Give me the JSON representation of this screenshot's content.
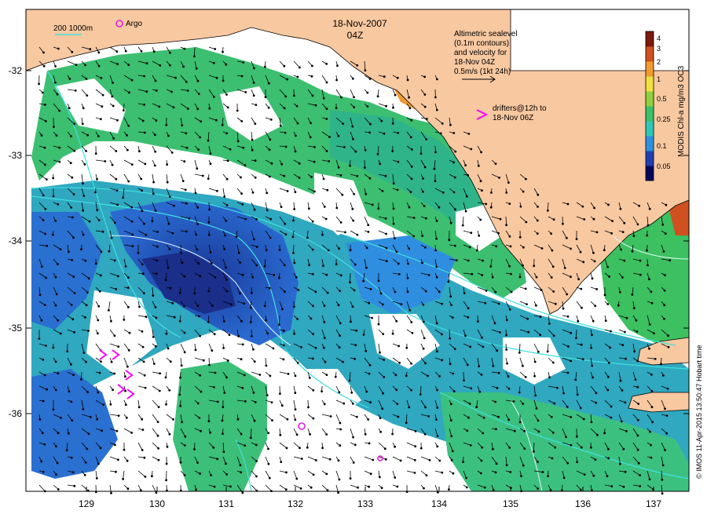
{
  "map": {
    "date_line": "18-Nov-2007",
    "time_line": "04Z",
    "scale_label": "200  1000m",
    "argo_label": "Argo",
    "altimetry_note": [
      "Altimetric sealevel",
      "(0.1m contours)",
      "and velocity for",
      "18-Nov 04Z",
      "0.5m/s (1kt 24h)"
    ],
    "drifters_note": [
      "drifters@12h to",
      "18-Nov 06Z"
    ],
    "lat_ticks": [
      "-32",
      "-33",
      "-34",
      "-35",
      "-36"
    ],
    "lon_ticks": [
      "129",
      "130",
      "131",
      "132",
      "133",
      "134",
      "135",
      "136",
      "137"
    ],
    "credit": "© IMOS 11-Apr-2015 13:50:47 Hobart time"
  },
  "colorbar": {
    "title": "MODIS Chl-a mg/m3 OC3",
    "ticks": [
      "4",
      "3",
      "2",
      "1",
      "0.5",
      "0.25",
      "0.1",
      "0.05"
    ],
    "colors": [
      "#08085a",
      "#1f3fb0",
      "#2f8fe0",
      "#2fc8b8",
      "#3cc06a",
      "#8fd040",
      "#f0e040",
      "#f09a30",
      "#d05020",
      "#7a1a10"
    ]
  },
  "colors": {
    "land": "#f8c8a0",
    "current_contour": "#40e0e0",
    "argo_marker": "#e020e0",
    "drifter": "#ff00ff"
  }
}
